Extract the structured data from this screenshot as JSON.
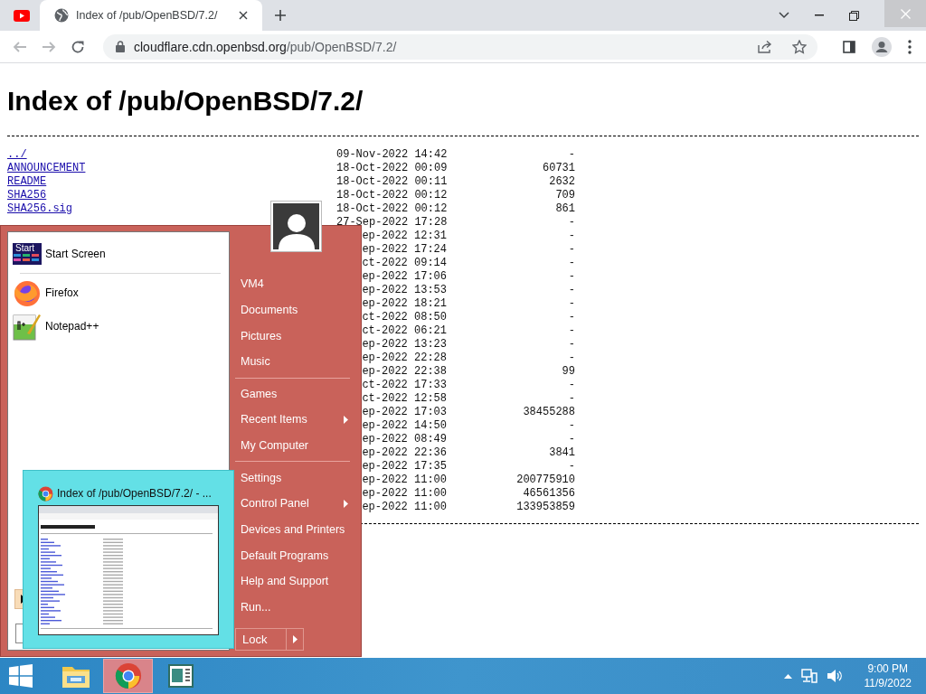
{
  "browser": {
    "tabs": [
      {
        "kind": "youtube",
        "selected": false
      },
      {
        "kind": "globe",
        "title": "Index of /pub/OpenBSD/7.2/",
        "selected": true
      }
    ],
    "nav": [
      {
        "kind": "back",
        "disabled": true
      },
      {
        "kind": "forward",
        "disabled": true
      },
      {
        "kind": "reload",
        "disabled": false
      }
    ],
    "address_bar": {
      "host": "cloudflare.cdn.openbsd.org",
      "path": "/pub/OpenBSD/7.2/"
    }
  },
  "page": {
    "heading": "Index of /pub/OpenBSD/7.2/",
    "rows": [
      {
        "name": "../",
        "date": "09-Nov-2022 14:42",
        "size": "-"
      },
      {
        "name": "ANNOUNCEMENT",
        "date": "18-Oct-2022 00:09",
        "size": "60731"
      },
      {
        "name": "README",
        "date": "18-Oct-2022 00:11",
        "size": "2632"
      },
      {
        "name": "SHA256",
        "date": "18-Oct-2022 00:12",
        "size": "709"
      },
      {
        "name": "SHA256.sig",
        "date": "18-Oct-2022 00:12",
        "size": "861"
      },
      {
        "date": "27-Sep-2022 17:28",
        "size": "-"
      },
      {
        "date": "ep-2022 12:31",
        "size": "-"
      },
      {
        "date": "ep-2022 17:24",
        "size": "-"
      },
      {
        "date": "ct-2022 09:14",
        "size": "-"
      },
      {
        "date": "ep-2022 17:06",
        "size": "-"
      },
      {
        "date": "ep-2022 13:53",
        "size": "-"
      },
      {
        "date": "ep-2022 18:21",
        "size": "-"
      },
      {
        "date": "ct-2022 08:50",
        "size": "-"
      },
      {
        "date": "ct-2022 06:21",
        "size": "-"
      },
      {
        "date": "ep-2022 13:23",
        "size": "-"
      },
      {
        "date": "ep-2022 22:28",
        "size": "-"
      },
      {
        "date": "ep-2022 22:38",
        "size": "99"
      },
      {
        "date": "ct-2022 17:33",
        "size": "-"
      },
      {
        "date": "ct-2022 12:58",
        "size": "-"
      },
      {
        "date": "ep-2022 17:03",
        "size": "38455288"
      },
      {
        "date": "ep-2022 14:50",
        "size": "-"
      },
      {
        "date": "ep-2022 08:49",
        "size": "-"
      },
      {
        "date": "ep-2022 22:36",
        "size": "3841"
      },
      {
        "date": "ep-2022 17:35",
        "size": "-"
      },
      {
        "date": "ep-2022 11:00",
        "size": "200775910"
      },
      {
        "date": "ep-2022 11:00",
        "size": "46561356"
      },
      {
        "date": "ep-2022 11:00",
        "size": "133953859"
      }
    ]
  },
  "start_menu": {
    "pinned": [
      {
        "kind": "start-screen",
        "icon_label": "Start",
        "label": "Start Screen",
        "separator_after": true
      },
      {
        "kind": "firefox",
        "label": "Firefox",
        "separator_after": false
      },
      {
        "kind": "notepad",
        "label": "Notepad++",
        "separator_after": false
      }
    ],
    "right_groups": [
      [
        {
          "label": "VM4",
          "submenu": false
        },
        {
          "label": "Documents",
          "submenu": false
        },
        {
          "label": "Pictures",
          "submenu": false
        },
        {
          "label": "Music",
          "submenu": false
        }
      ],
      [
        {
          "label": "Games",
          "submenu": false
        },
        {
          "label": "Recent Items",
          "submenu": true
        },
        {
          "label": "My Computer",
          "submenu": false
        }
      ],
      [
        {
          "label": "Settings",
          "submenu": false
        },
        {
          "label": "Control Panel",
          "submenu": true
        },
        {
          "label": "Devices and Printers",
          "submenu": false
        },
        {
          "label": "Default Programs",
          "submenu": false
        },
        {
          "label": "Help and Support",
          "submenu": false
        },
        {
          "label": "Run...",
          "submenu": false
        }
      ]
    ],
    "power_button": "Lock"
  },
  "thumbnail": {
    "title": "Index of /pub/OpenBSD/7.2/ - ..."
  },
  "taskbar": {
    "items": [
      {
        "kind": "explorer",
        "selected": false
      },
      {
        "kind": "chrome",
        "selected": true
      },
      {
        "kind": "app",
        "selected": false
      }
    ],
    "time": "9:00 PM",
    "date": "11/9/2022"
  }
}
